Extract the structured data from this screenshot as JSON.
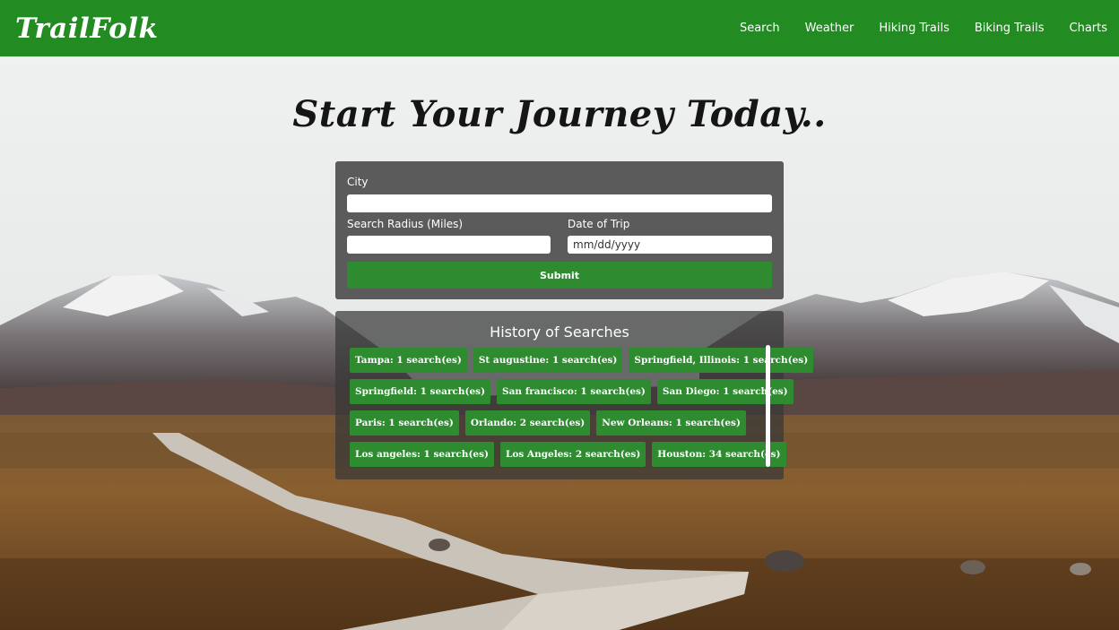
{
  "brand": "TrailFolk",
  "nav": [
    "Search",
    "Weather",
    "Hiking Trails",
    "Biking Trails",
    "Charts"
  ],
  "headline": "Start Your Journey Today..",
  "form": {
    "city_label": "City",
    "radius_label": "Search Radius (Miles)",
    "date_label": "Date of Trip",
    "date_placeholder": "mm/dd/yyyy",
    "submit_label": "Submit"
  },
  "history": {
    "title": "History of Searches",
    "rows": [
      [
        "Tampa: 1 search(es)",
        "St augustine: 1 search(es)",
        "Springfield, Illinois: 1 search(es)"
      ],
      [
        "Springfield: 1 search(es)",
        "San francisco: 1 search(es)",
        "San Diego: 1 search(es)"
      ],
      [
        "Paris: 1 search(es)",
        "Orlando: 2 search(es)",
        "New Orleans: 1 search(es)"
      ],
      [
        "Los angeles: 1 search(es)",
        "Los Angeles: 2 search(es)",
        "Houston: 34 search(es)"
      ]
    ]
  },
  "colors": {
    "navbar": "#228b22",
    "button": "#2e8b30"
  }
}
